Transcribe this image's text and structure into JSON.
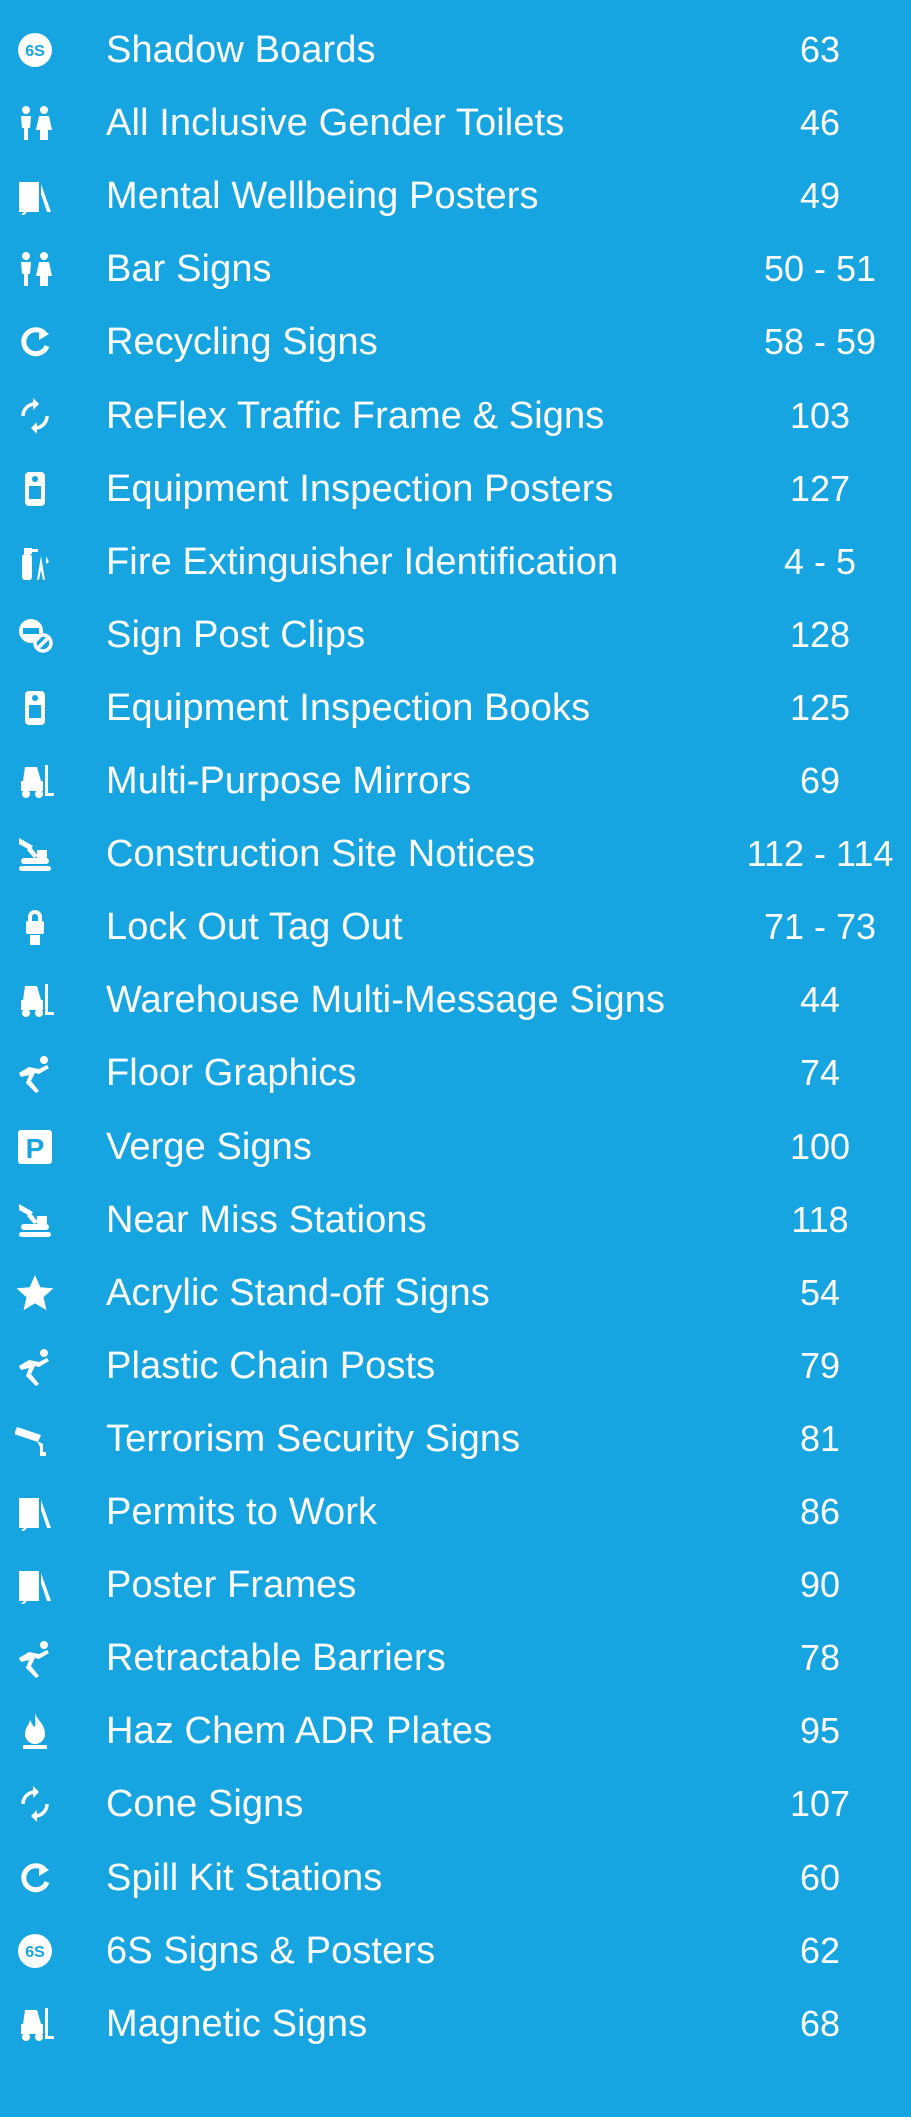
{
  "colors": {
    "background": "#16a5e0",
    "text": "#ffffff"
  },
  "items": [
    {
      "icon": "6s-badge-icon",
      "label": "Shadow Boards",
      "page": "63"
    },
    {
      "icon": "toilet-people-icon",
      "label": "All Inclusive Gender Toilets",
      "page": "46"
    },
    {
      "icon": "poster-board-icon",
      "label": "Mental Wellbeing Posters",
      "page": "49"
    },
    {
      "icon": "toilet-people-icon",
      "label": "Bar Signs",
      "page": "50 - 51"
    },
    {
      "icon": "recycle-arrow-icon",
      "label": "Recycling Signs",
      "page": "58 - 59"
    },
    {
      "icon": "rotating-arrows-icon",
      "label": "ReFlex Traffic Frame & Signs",
      "page": "103"
    },
    {
      "icon": "inspection-tag-icon",
      "label": "Equipment Inspection Posters",
      "page": "127"
    },
    {
      "icon": "fire-extinguisher-icon",
      "label": "Fire Extinguisher Identification",
      "page": "4 - 5"
    },
    {
      "icon": "no-entry-clip-icon",
      "label": "Sign Post Clips",
      "page": "128"
    },
    {
      "icon": "inspection-tag-icon",
      "label": "Equipment Inspection Books",
      "page": "125"
    },
    {
      "icon": "forklift-icon",
      "label": "Multi-Purpose Mirrors",
      "page": "69"
    },
    {
      "icon": "excavator-icon",
      "label": "Construction Site Notices",
      "page": "112 - 114"
    },
    {
      "icon": "padlock-tag-icon",
      "label": "Lock Out Tag Out",
      "page": "71 - 73"
    },
    {
      "icon": "forklift-icon",
      "label": "Warehouse Multi-Message Signs",
      "page": "44"
    },
    {
      "icon": "slipping-person-icon",
      "label": "Floor Graphics",
      "page": "74"
    },
    {
      "icon": "parking-p-icon",
      "label": "Verge Signs",
      "page": "100"
    },
    {
      "icon": "excavator-icon",
      "label": "Near Miss Stations",
      "page": "118"
    },
    {
      "icon": "star-icon",
      "label": "Acrylic Stand-off Signs",
      "page": "54"
    },
    {
      "icon": "slipping-person-icon",
      "label": "Plastic Chain Posts",
      "page": "79"
    },
    {
      "icon": "cctv-camera-icon",
      "label": "Terrorism Security Signs",
      "page": "81"
    },
    {
      "icon": "poster-board-icon",
      "label": "Permits to Work",
      "page": "86"
    },
    {
      "icon": "poster-board-icon",
      "label": "Poster Frames",
      "page": "90"
    },
    {
      "icon": "slipping-person-icon",
      "label": "Retractable Barriers",
      "page": "78"
    },
    {
      "icon": "flame-icon",
      "label": "Haz Chem ADR Plates",
      "page": "95"
    },
    {
      "icon": "rotating-arrows-icon",
      "label": "Cone Signs",
      "page": "107"
    },
    {
      "icon": "recycle-arrow-icon",
      "label": "Spill Kit Stations",
      "page": "60"
    },
    {
      "icon": "6s-badge-icon",
      "label": "6S Signs & Posters",
      "page": "62"
    },
    {
      "icon": "forklift-icon",
      "label": "Magnetic Signs",
      "page": "68"
    }
  ]
}
